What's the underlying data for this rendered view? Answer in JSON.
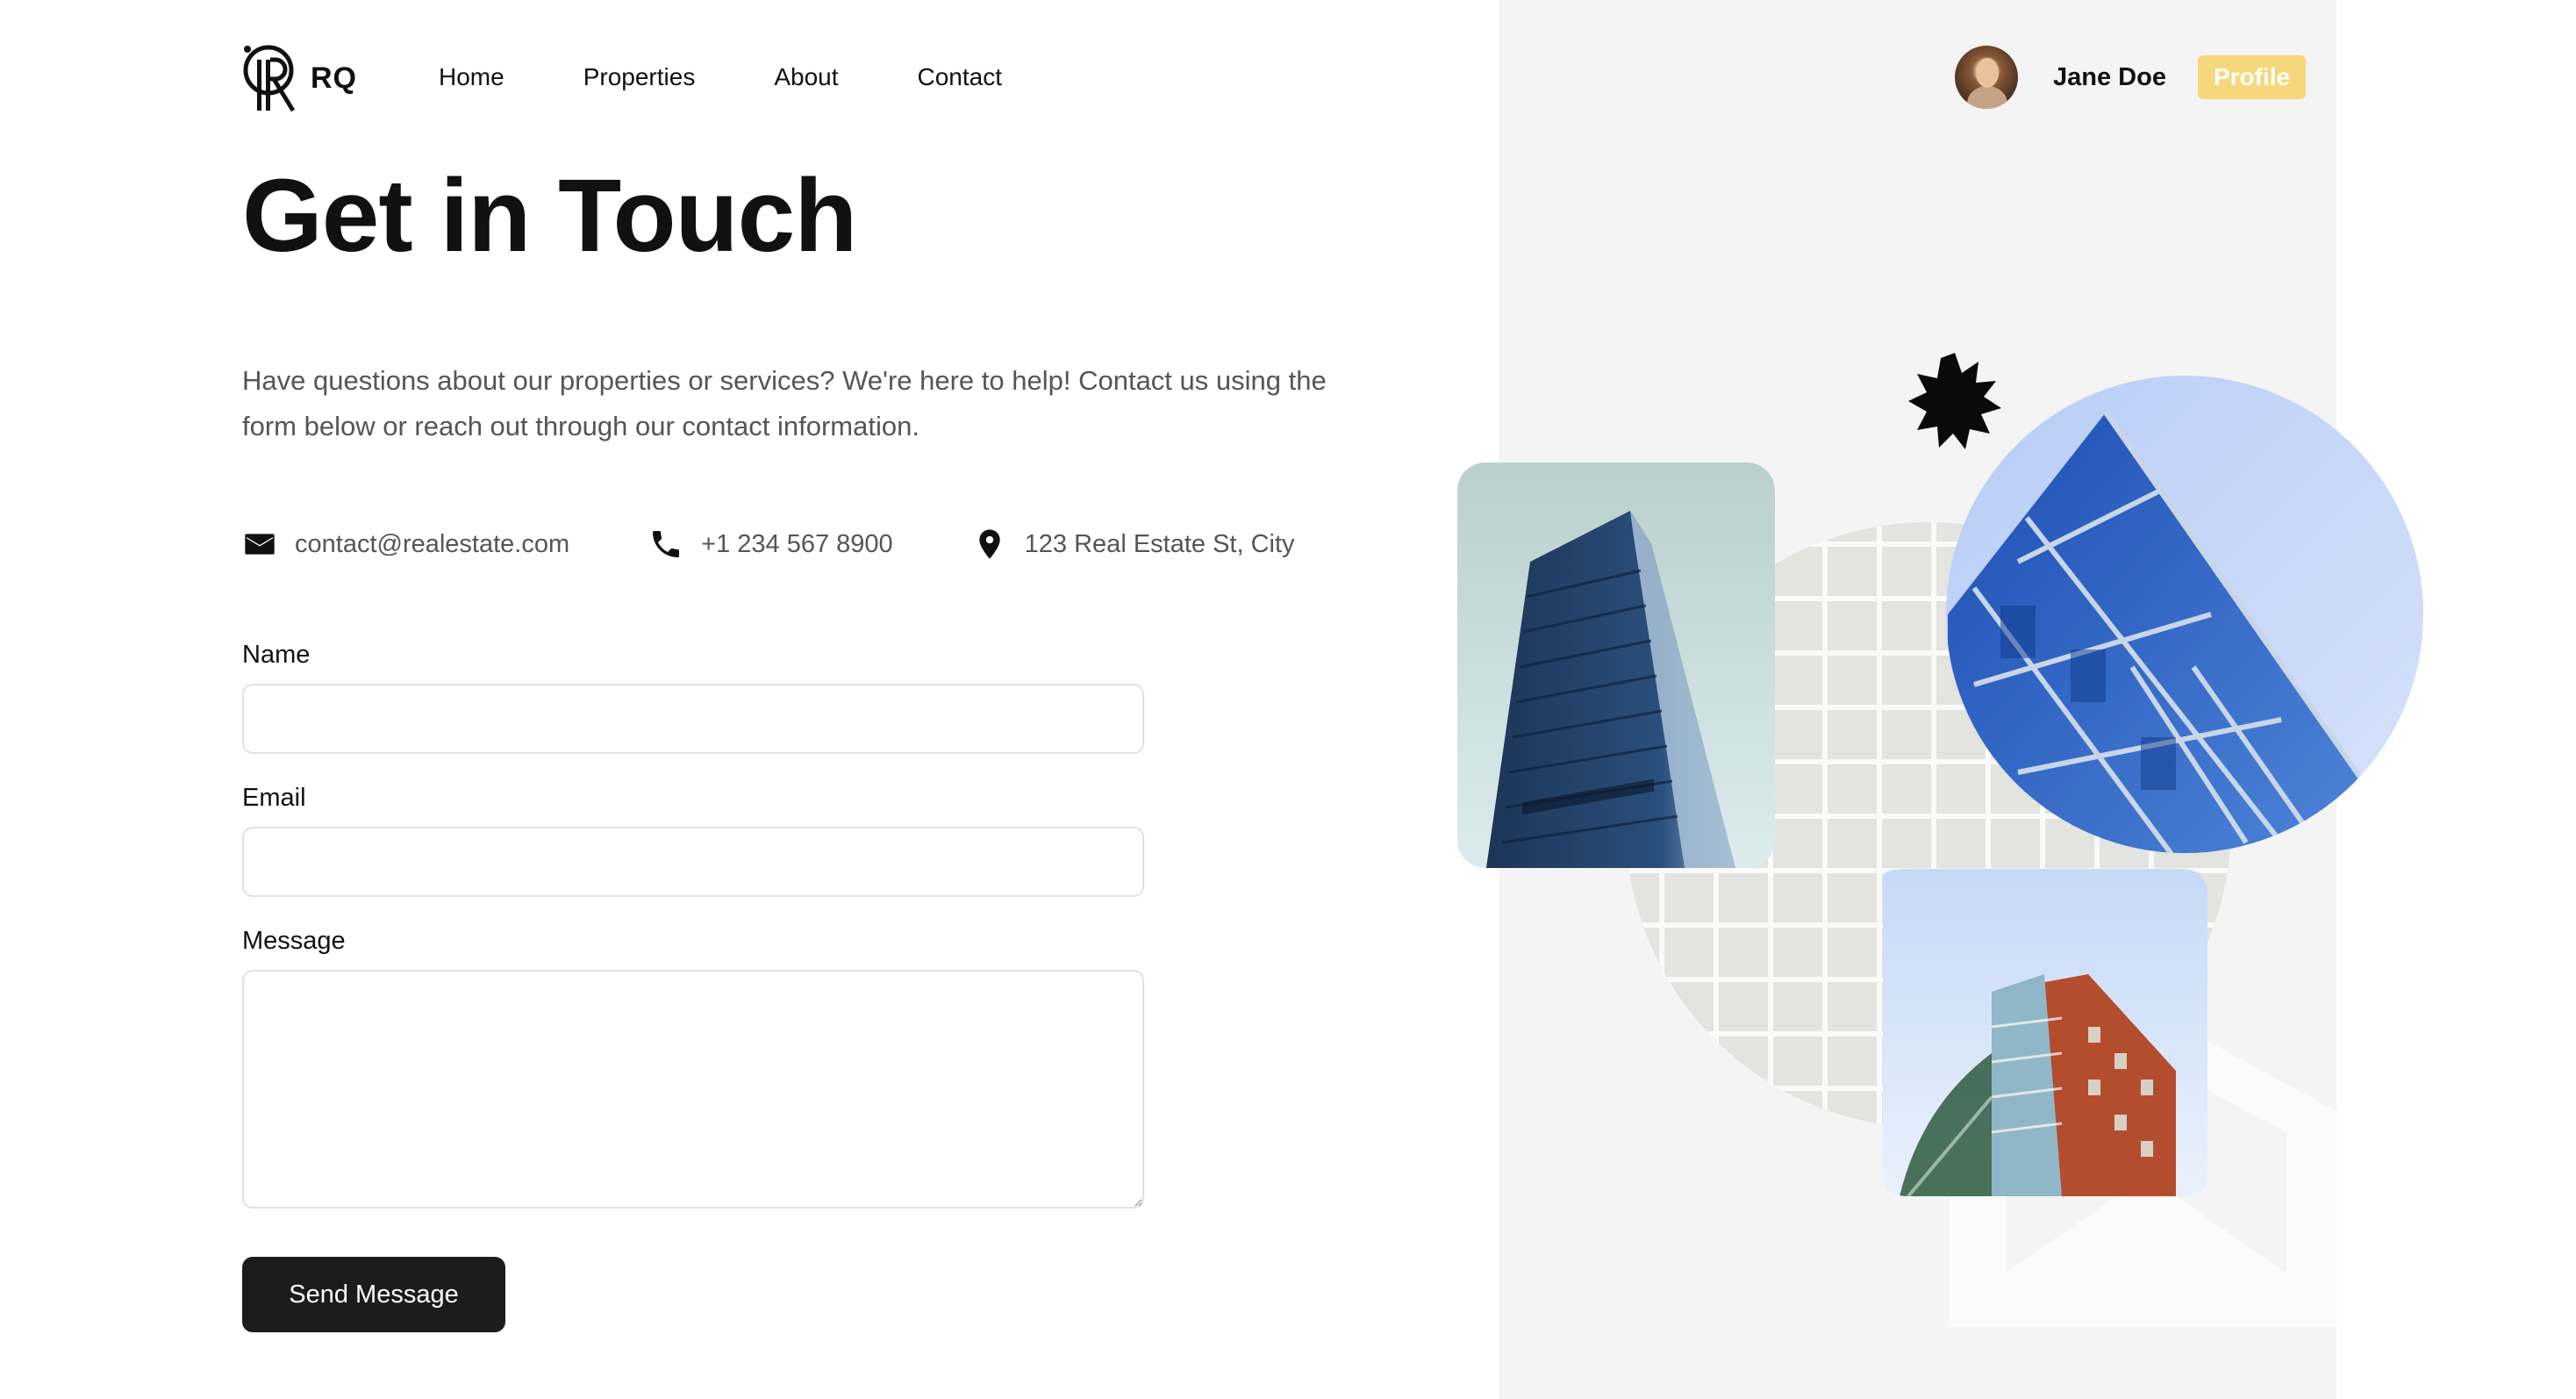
{
  "brand": {
    "name": "RQ"
  },
  "nav": {
    "items": [
      "Home",
      "Properties",
      "About",
      "Contact"
    ]
  },
  "user": {
    "name": "Jane Doe",
    "profile_label": "Profile"
  },
  "page": {
    "title": "Get in Touch",
    "intro": "Have questions about our properties or services? We're here to help! Contact us using the form below or reach out through our contact information."
  },
  "contact": {
    "email": "contact@realestate.com",
    "phone": "+1 234 567 8900",
    "address": "123 Real Estate St, City"
  },
  "form": {
    "name_label": "Name",
    "name_value": "",
    "email_label": "Email",
    "email_value": "",
    "message_label": "Message",
    "message_value": "",
    "submit_label": "Send Message"
  },
  "colors": {
    "accent": "#f6d77a",
    "button": "#1c1c1c",
    "panel": "#f4f4f4"
  }
}
